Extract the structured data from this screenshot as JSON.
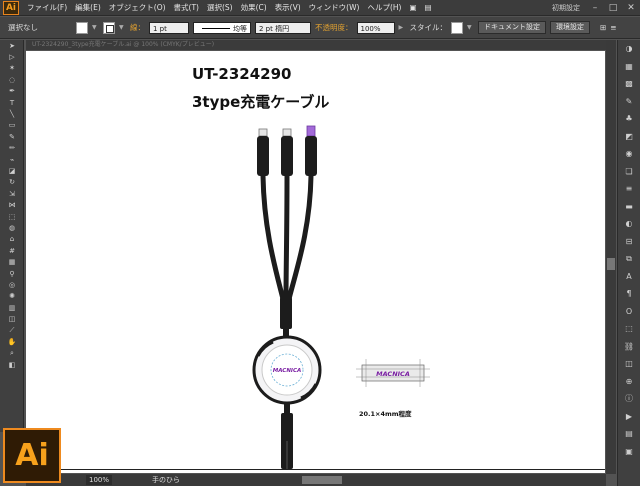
{
  "app": {
    "logo": "Ai"
  },
  "menu": {
    "items": [
      "ファイル(F)",
      "編集(E)",
      "オブジェクト(O)",
      "書式(T)",
      "選択(S)",
      "効果(C)",
      "表示(V)",
      "ウィンドウ(W)",
      "ヘルプ(H)"
    ],
    "workspace": "初期設定"
  },
  "control": {
    "selection": "選択なし",
    "stroke_label": "線：",
    "stroke_weight": "1 pt",
    "stroke_profile": "均等",
    "brush": "2 pt 楕円",
    "opacity_label": "不透明度：",
    "opacity": "100%",
    "style_label": "スタイル：",
    "doc_settings": "ドキュメント設定",
    "prefs": "環境設定"
  },
  "tab": {
    "title": "UT-2324290_3type充電ケーブル.ai @ 100% (CMYK/プレビュー)"
  },
  "artwork": {
    "line1": "UT-2324290",
    "line2": "3type充電ケーブル",
    "logo_text": "MACNICA",
    "caption": "20.1×4mm程度"
  },
  "status": {
    "zoom": "100%",
    "tool": "手のひら"
  },
  "colors": {
    "logo": "#7a1fa3",
    "ai_orange": "#f39c1f",
    "cable": "#1c1c1c"
  },
  "icons": {
    "tools": [
      "selection-icon",
      "direct-selection-icon",
      "magic-wand-icon",
      "lasso-icon",
      "pen-icon",
      "type-icon",
      "line-icon",
      "rectangle-icon",
      "brush-icon",
      "pencil-icon",
      "blob-brush-icon",
      "eraser-icon",
      "rotate-icon",
      "scale-icon",
      "width-icon",
      "free-transform-icon",
      "shape-builder-icon",
      "perspective-icon",
      "mesh-icon",
      "gradient-icon",
      "eyedropper-icon",
      "blend-icon",
      "symbol-sprayer-icon",
      "graph-icon",
      "artboard-icon",
      "slice-icon",
      "hand-icon",
      "zoom-icon"
    ],
    "panels": [
      "color-icon",
      "color-guide-icon",
      "swatches-icon",
      "brushes-icon",
      "symbols-icon",
      "graphic-styles-icon",
      "appearance-icon",
      "layers-icon",
      "stroke-icon",
      "gradient-panel-icon",
      "transparency-icon",
      "align-icon",
      "pathfinder-icon",
      "character-icon",
      "paragraph-icon",
      "opentype-icon",
      "transform-icon",
      "links-icon",
      "artboards-icon",
      "navigator-icon",
      "info-icon",
      "actions-icon",
      "document-info-icon",
      "attributes-icon"
    ]
  }
}
